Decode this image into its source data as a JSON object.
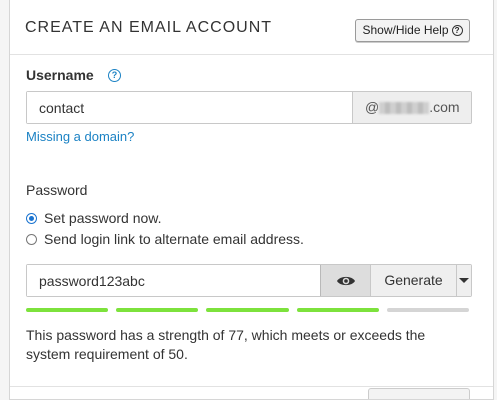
{
  "header": {
    "title": "CREATE AN EMAIL ACCOUNT",
    "help_button_label": "Show/Hide Help",
    "help_icon": "question-circle-icon"
  },
  "username": {
    "label": "Username",
    "info_icon": "question-circle-icon",
    "value": "contact",
    "domain_prefix": "@",
    "domain_suffix": ".com",
    "missing_domain_link": "Missing a domain?"
  },
  "password": {
    "label": "Password",
    "options": [
      {
        "label": "Set password now.",
        "selected": true
      },
      {
        "label": "Send login link to alternate email address.",
        "selected": false
      }
    ],
    "value": "password123abc",
    "eye_icon": "eye-icon",
    "generate_label": "Generate",
    "dropdown_icon": "caret-down-icon",
    "strength_segments_total": 5,
    "strength_segments_filled": 4,
    "strength_text": "This password has a strength of 77, which meets or exceeds the system requirement of 50.",
    "colors": {
      "meter_fill": "#7de23c",
      "meter_empty": "#d5d5d5",
      "link": "#1b82c4",
      "radio": "#1b74d0"
    }
  }
}
